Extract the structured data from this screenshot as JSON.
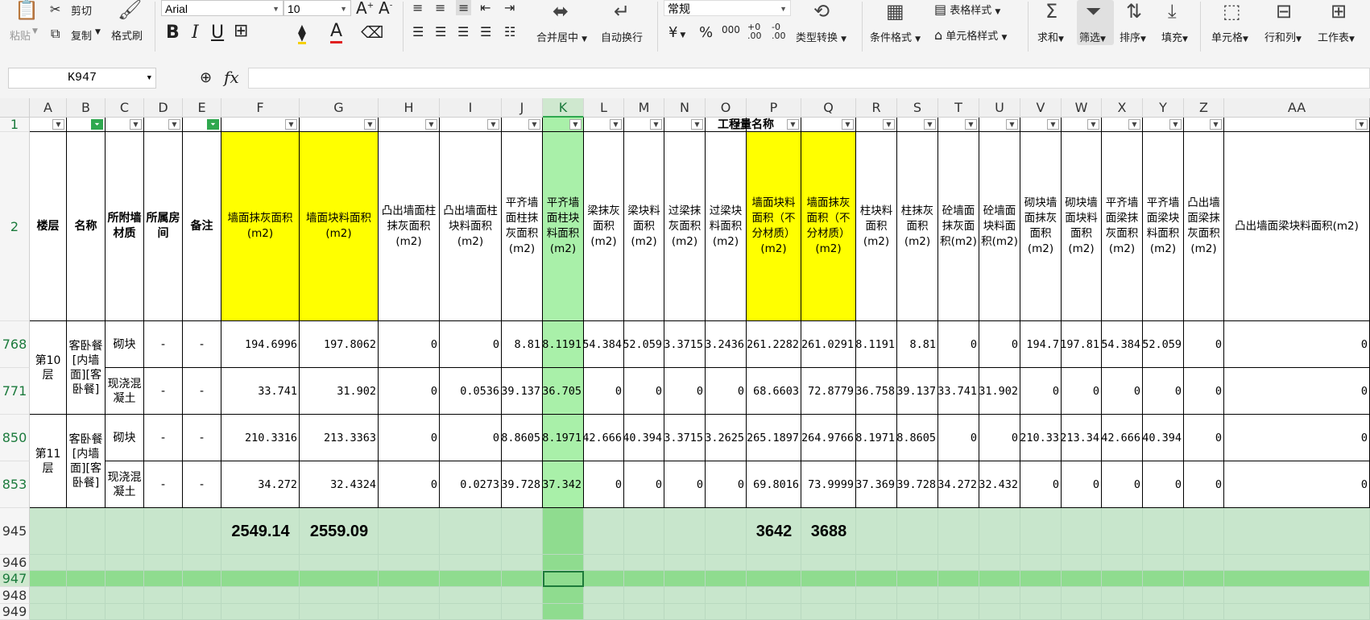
{
  "ribbon": {
    "paste_label": "粘贴",
    "cut_label": "剪切",
    "copy_label": "复制",
    "format_painter_label": "格式刷",
    "font_name": "Arial",
    "font_size": "10",
    "merge_label": "合并居中",
    "wrap_label": "自动换行",
    "number_format": "常规",
    "type_convert_label": "类型转换",
    "cond_format_label": "条件格式",
    "table_style_label": "表格样式",
    "cell_style_label": "单元格样式",
    "sum_label": "求和",
    "filter_label": "筛选",
    "sort_label": "排序",
    "fill_label": "填充",
    "cell_label": "单元格",
    "rowcol_label": "行和列",
    "sheet_label": "工作表"
  },
  "formula_bar": {
    "name_box": "K947",
    "fx": "fx",
    "content": ""
  },
  "columns": [
    "A",
    "B",
    "C",
    "D",
    "E",
    "F",
    "G",
    "H",
    "I",
    "J",
    "K",
    "L",
    "M",
    "N",
    "O",
    "P",
    "Q",
    "R",
    "S",
    "T",
    "U",
    "V",
    "W",
    "X",
    "Y",
    "Z",
    "AA"
  ],
  "selected_column": "K",
  "row_numbers": [
    "1",
    "2",
    "768",
    "771",
    "850",
    "853",
    "945",
    "946",
    "947",
    "948",
    "949"
  ],
  "row1_label": "工程量名称",
  "headers": [
    "楼层",
    "名称",
    "所附墙材质",
    "所属房间",
    "备注",
    "墙面抹灰面积(m2)",
    "墙面块料面积(m2)",
    "凸出墙面柱抹灰面积(m2)",
    "凸出墙面柱块料面积(m2)",
    "平齐墙面柱抹灰面积(m2)",
    "平齐墙面柱块料面积(m2)",
    "梁抹灰面积(m2)",
    "梁块料面积(m2)",
    "过梁抹灰面积(m2)",
    "过梁块料面积(m2)",
    "墙面块料面积（不分材质）(m2)",
    "墙面抹灰面积（不分材质）(m2)",
    "柱块料面积(m2)",
    "柱抹灰面积(m2)",
    "砼墙面抹灰面积(m2)",
    "砼墙面块料面积(m2)",
    "砌块墙面抹灰面积(m2)",
    "砌块墙面块料面积(m2)",
    "平齐墙面梁抹灰面积(m2)",
    "平齐墙面梁块料面积(m2)",
    "凸出墙面梁抹灰面积(m2)",
    "凸出墙面梁块料面积(m2)"
  ],
  "groups": [
    {
      "floor": "第10层",
      "name": "客卧餐[内墙面][客卧餐]"
    },
    {
      "floor": "第11层",
      "name": "客卧餐[内墙面][客卧餐]"
    }
  ],
  "rows": [
    {
      "material": "砌块",
      "room": "-",
      "note": "-",
      "values": [
        "194.6996",
        "197.8062",
        "0",
        "0",
        "8.81",
        "8.1191",
        "54.384",
        "52.059",
        "3.3715",
        "3.2436",
        "261.2282",
        "261.0291",
        "8.1191",
        "8.81",
        "0",
        "0",
        "194.7",
        "197.81",
        "54.384",
        "52.059",
        "0",
        "0"
      ]
    },
    {
      "material": "现浇混凝土",
      "room": "-",
      "note": "-",
      "values": [
        "33.741",
        "31.902",
        "0",
        "0.0536",
        "39.137",
        "36.705",
        "0",
        "0",
        "0",
        "0",
        "68.6603",
        "72.8779",
        "36.758",
        "39.137",
        "33.741",
        "31.902",
        "0",
        "0",
        "0",
        "0",
        "0",
        "0"
      ]
    },
    {
      "material": "砌块",
      "room": "-",
      "note": "-",
      "values": [
        "210.3316",
        "213.3363",
        "0",
        "0",
        "8.8605",
        "8.1971",
        "42.666",
        "40.394",
        "3.3715",
        "3.2625",
        "265.1897",
        "264.9766",
        "8.1971",
        "8.8605",
        "0",
        "0",
        "210.33",
        "213.34",
        "42.666",
        "40.394",
        "0",
        "0"
      ]
    },
    {
      "material": "现浇混凝土",
      "room": "-",
      "note": "-",
      "values": [
        "34.272",
        "32.4324",
        "0",
        "0.0273",
        "39.728",
        "37.342",
        "0",
        "0",
        "0",
        "0",
        "69.8016",
        "73.9999",
        "37.369",
        "39.728",
        "34.272",
        "32.432",
        "0",
        "0",
        "0",
        "0",
        "0",
        "0"
      ]
    }
  ],
  "totals": {
    "F": "2549.14",
    "G": "2559.09",
    "P": "3642",
    "Q": "3688"
  },
  "colors": {
    "yellow": "#ffff00",
    "green_col": "#a9f0a9",
    "green_row": "#c8e6cc",
    "selected_row": "#8fdc8f",
    "row_numbers": "#1b7a3c"
  }
}
